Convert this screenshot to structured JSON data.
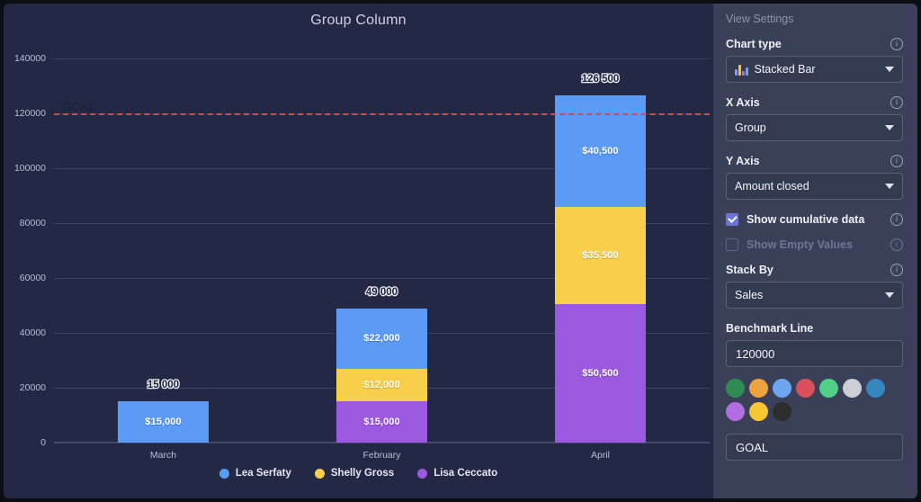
{
  "chart": {
    "title": "Group Column",
    "benchmark_label": "GOAL"
  },
  "chart_data": {
    "type": "bar",
    "subtype": "stacked-bar",
    "title": "Group Column",
    "xlabel": "",
    "ylabel": "",
    "ylim": [
      0,
      145000
    ],
    "yticks": [
      0,
      20000,
      40000,
      60000,
      80000,
      100000,
      120000,
      140000
    ],
    "ytick_labels": [
      "0",
      "20000",
      "40000",
      "60000",
      "80000",
      "100000",
      "120000",
      "140000"
    ],
    "grid": true,
    "legend_position": "bottom",
    "categories": [
      "March",
      "February",
      "April"
    ],
    "series": [
      {
        "name": "Lea Serfaty",
        "color": "#5b9bf5",
        "values": [
          15000,
          22000,
          40500
        ],
        "labels": [
          "$15,000",
          "$22,000",
          "$40,500"
        ]
      },
      {
        "name": "Shelly Gross",
        "color": "#f7cf4a",
        "values": [
          0,
          12000,
          35500
        ],
        "labels": [
          "",
          "$12,000",
          "$35,500"
        ]
      },
      {
        "name": "Lisa Ceccato",
        "color": "#9b59e0",
        "values": [
          0,
          15000,
          50500
        ],
        "labels": [
          "",
          "$15,000",
          "$50,500"
        ]
      }
    ],
    "totals": [
      15000,
      49000,
      126500
    ],
    "total_labels": [
      "15 000",
      "49 000",
      "126 500"
    ],
    "benchmark": {
      "value": 120000,
      "label": "GOAL",
      "color": "#e0463c",
      "style": "dashed"
    }
  },
  "sidebar": {
    "title": "View Settings",
    "chart_type": {
      "label": "Chart type",
      "value": "Stacked Bar"
    },
    "x_axis": {
      "label": "X Axis",
      "value": "Group"
    },
    "y_axis": {
      "label": "Y Axis",
      "value": "Amount closed"
    },
    "show_cumulative": {
      "label": "Show cumulative data",
      "checked": true
    },
    "show_empty": {
      "label": "Show Empty Values",
      "checked": false
    },
    "stack_by": {
      "label": "Stack By",
      "value": "Sales"
    },
    "benchmark_line": {
      "label": "Benchmark Line",
      "value": "120000"
    },
    "benchmark_name": {
      "value": "GOAL"
    },
    "swatches": [
      "#2f8d54",
      "#eda340",
      "#6ca5f0",
      "#d94f5c",
      "#4fcf87",
      "#cccfd3",
      "#3387bd",
      "#b06ee0",
      "#f6c633",
      "#2d2d2d"
    ]
  }
}
